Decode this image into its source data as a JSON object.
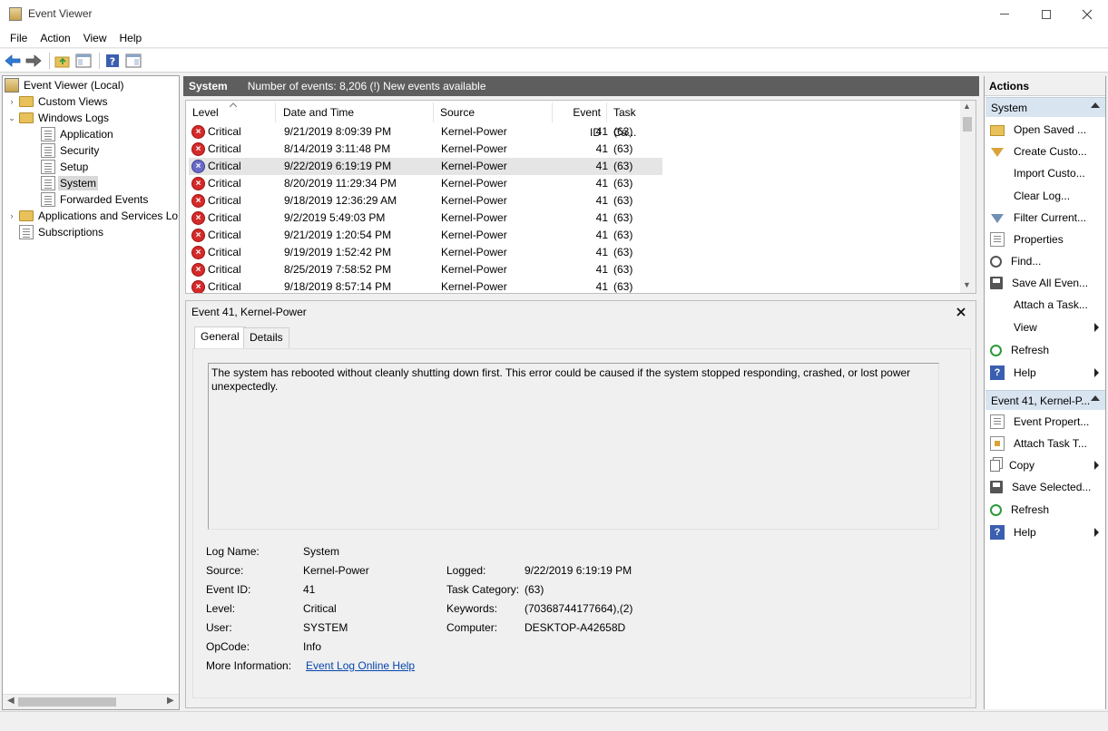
{
  "window": {
    "title": "Event Viewer"
  },
  "menu": [
    "File",
    "Action",
    "View",
    "Help"
  ],
  "tree": {
    "items": [
      {
        "label": "Event Viewer (Local)"
      },
      {
        "label": "Custom Views"
      },
      {
        "label": "Windows Logs"
      },
      {
        "label": "Application"
      },
      {
        "label": "Security"
      },
      {
        "label": "Setup"
      },
      {
        "label": "System"
      },
      {
        "label": "Forwarded Events"
      },
      {
        "label": "Applications and Services Lo"
      },
      {
        "label": "Subscriptions"
      }
    ]
  },
  "center": {
    "log_name": "System",
    "summary": "Number of events: 8,206 (!) New events available"
  },
  "events": {
    "columns": [
      "Level",
      "Date and Time",
      "Source",
      "Event ID",
      "Task Ca..."
    ],
    "rows": [
      {
        "level": "Critical",
        "datetime": "9/21/2019 8:09:39 PM",
        "source": "Kernel-Power",
        "event_id": "41",
        "task": "(63)"
      },
      {
        "level": "Critical",
        "datetime": "8/14/2019 3:11:48 PM",
        "source": "Kernel-Power",
        "event_id": "41",
        "task": "(63)"
      },
      {
        "level": "Critical",
        "datetime": "9/22/2019 6:19:19 PM",
        "source": "Kernel-Power",
        "event_id": "41",
        "task": "(63)"
      },
      {
        "level": "Critical",
        "datetime": "8/20/2019 11:29:34 PM",
        "source": "Kernel-Power",
        "event_id": "41",
        "task": "(63)"
      },
      {
        "level": "Critical",
        "datetime": "9/18/2019 12:36:29 AM",
        "source": "Kernel-Power",
        "event_id": "41",
        "task": "(63)"
      },
      {
        "level": "Critical",
        "datetime": "9/2/2019 5:49:03 PM",
        "source": "Kernel-Power",
        "event_id": "41",
        "task": "(63)"
      },
      {
        "level": "Critical",
        "datetime": "9/21/2019 1:20:54 PM",
        "source": "Kernel-Power",
        "event_id": "41",
        "task": "(63)"
      },
      {
        "level": "Critical",
        "datetime": "9/19/2019 1:52:42 PM",
        "source": "Kernel-Power",
        "event_id": "41",
        "task": "(63)"
      },
      {
        "level": "Critical",
        "datetime": "8/25/2019 7:58:52 PM",
        "source": "Kernel-Power",
        "event_id": "41",
        "task": "(63)"
      },
      {
        "level": "Critical",
        "datetime": "9/18/2019 8:57:14 PM",
        "source": "Kernel-Power",
        "event_id": "41",
        "task": "(63)"
      }
    ]
  },
  "detail": {
    "title": "Event 41, Kernel-Power",
    "tabs": [
      "General",
      "Details"
    ],
    "description": "The system has rebooted without cleanly shutting down first. This error could be caused if the system stopped responding, crashed, or lost power unexpectedly.",
    "fields": {
      "log_name_label": "Log Name:",
      "log_name": "System",
      "source_label": "Source:",
      "source": "Kernel-Power",
      "logged_label": "Logged:",
      "logged": "9/22/2019 6:19:19 PM",
      "event_id_label": "Event ID:",
      "event_id": "41",
      "task_category_label": "Task Category:",
      "task_category": "(63)",
      "level_label": "Level:",
      "level": "Critical",
      "keywords_label": "Keywords:",
      "keywords": "(70368744177664),(2)",
      "user_label": "User:",
      "user": "SYSTEM",
      "computer_label": "Computer:",
      "computer": "DESKTOP-A42658D",
      "opcode_label": "OpCode:",
      "opcode": "Info",
      "more_info_label": "More Information:",
      "more_info_link": "Event Log Online Help"
    }
  },
  "actions": {
    "title": "Actions",
    "section1": "System",
    "section1_items": [
      "Open Saved ...",
      "Create Custo...",
      "Import Custo...",
      "Clear Log...",
      "Filter Current...",
      "Properties",
      "Find...",
      "Save All Even...",
      "Attach a Task...",
      "View",
      "Refresh",
      "Help"
    ],
    "section2": "Event 41, Kernel-P...",
    "section2_items": [
      "Event Propert...",
      "Attach Task T...",
      "Copy",
      "Save Selected...",
      "Refresh",
      "Help"
    ]
  }
}
